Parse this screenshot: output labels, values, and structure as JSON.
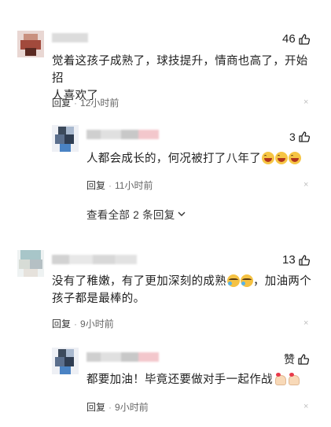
{
  "comments": [
    {
      "likes": "46",
      "text_line1": "觉着这孩子成熟了，球技提升，情商也高了，开始招",
      "text_line2": "人喜欢了",
      "reply_label": "回复",
      "time": "12小时前",
      "reply": {
        "likes": "3",
        "text": "人都会成长的，何况被打了八年了",
        "emojis": [
          "laugh",
          "laugh",
          "laugh"
        ],
        "reply_label": "回复",
        "time": "11小时前"
      },
      "see_all": "查看全部 2 条回复"
    },
    {
      "likes": "13",
      "text_line1": "没有了稚嫩，有了更加深刻的成熟",
      "text_line1_after": "，加油两个",
      "text_line1_emojis": [
        "cry",
        "cry"
      ],
      "text_line2": "孩子都是最棒的。",
      "reply_label": "回复",
      "time": "9小时前",
      "reply": {
        "likes": "赞",
        "text": "都要加油！毕竟还要做对手一起作战",
        "emojis": [
          "pray",
          "pray"
        ],
        "reply_label": "回复",
        "time": "9小时前"
      }
    }
  ],
  "icons": {
    "thumb": "thumbs-up-icon",
    "close": "close-icon",
    "chevron": "chevron-down-icon"
  },
  "colors": {
    "text": "#222222",
    "meta": "#666666",
    "close": "#c0c0c0"
  },
  "close_glyph": "×"
}
